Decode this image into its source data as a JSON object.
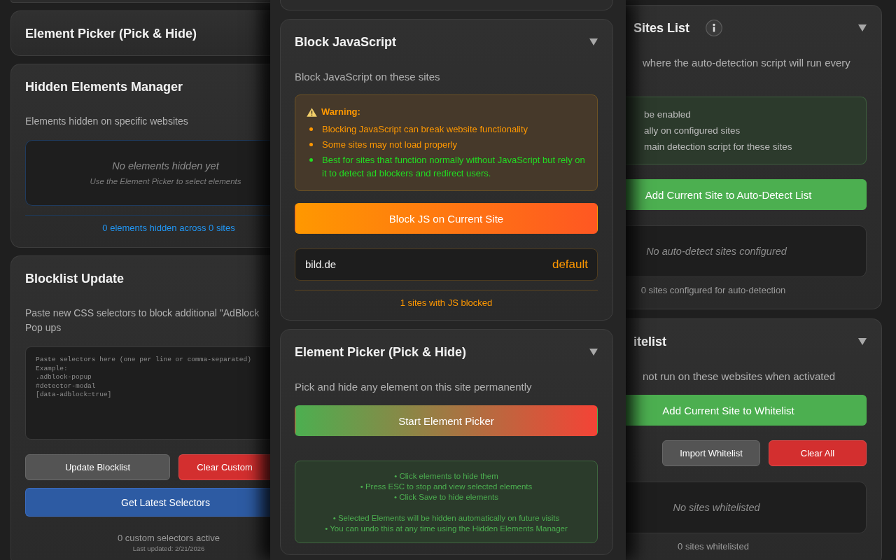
{
  "left_panel": {
    "cards": [
      {
        "kind": "plain",
        "title": "Element Picker (Pick & Hide)"
      },
      {
        "kind": "info",
        "title": "Hidden Elements Manager",
        "blocks": [
          {
            "kind": "description",
            "text": "Elements hidden on specific websites"
          },
          {
            "kind": "empty",
            "title": "No elements hidden yet",
            "hint": "Use the Element Picker to select elements"
          },
          {
            "kind": "divider"
          },
          {
            "kind": "summary",
            "text": "0 elements hidden across 0 sites"
          }
        ]
      },
      {
        "kind": "plain",
        "title": "Blocklist Update",
        "blocks": [
          {
            "kind": "description",
            "text": "Paste new CSS selectors to block additional \"AdBlock\nPop ups"
          },
          {
            "kind": "textarea",
            "placeholder": "Paste selectors here (one per line or comma-separated)\nExample:\n.adblock-popup\n#detector-modal\n[data-adblock=true]"
          },
          {
            "kind": "buttons",
            "buttons": [
              {
                "label": "Update Blocklist",
                "kind": "neutral"
              },
              {
                "label": "Clear Custom",
                "kind": "danger"
              }
            ]
          },
          {
            "kind": "buttons",
            "buttons": [
              {
                "label": "Get Latest Selectors",
                "kind": "primary"
              }
            ]
          },
          {
            "kind": "summary",
            "text": "0 custom selectors active",
            "note": "Last updated: 2/21/2026"
          }
        ]
      }
    ]
  },
  "center_panel": {
    "cards": [
      {
        "kind": "warning",
        "title": "Block JavaScript",
        "blocks": [
          {
            "kind": "description",
            "text": "Block JavaScript on these sites"
          },
          {
            "kind": "warning",
            "title": "Warning:",
            "items": [
              {
                "text": "Blocking JavaScript can break website functionality",
                "color": "#ff9800"
              },
              {
                "text": "Some sites may not load properly",
                "color": "#ff9800"
              },
              {
                "text": "Best for sites that function normally without JavaScript but rely on it to detect ad blockers and redirect users.",
                "color": "#22dd22"
              }
            ]
          },
          {
            "kind": "buttons",
            "buttons": [
              {
                "label": "Block JS on Current Site",
                "kind": "warning"
              }
            ]
          },
          {
            "kind": "sites",
            "sites": [
              {
                "name": "bild.de",
                "tag": "default"
              }
            ]
          },
          {
            "kind": "divider"
          },
          {
            "kind": "summary",
            "text": "1 sites with JS blocked"
          }
        ]
      },
      {
        "kind": "plain",
        "title": "Element Picker (Pick & Hide)",
        "blocks": [
          {
            "kind": "description",
            "text": "Pick and hide any element on this site permanently"
          },
          {
            "kind": "buttons",
            "buttons": [
              {
                "label": "Start Element Picker",
                "kind": "picker"
              }
            ]
          },
          {
            "kind": "tips",
            "groups": [
              [
                "• Click elements to hide them",
                "• Press ESC to stop and view selected elements",
                "• Click Save to hide elements"
              ],
              [
                "• Selected Elements will be hidden automatically on future visits",
                "• You can undo this at any time using the Hidden Elements Manager"
              ]
            ]
          }
        ]
      }
    ]
  },
  "right_panel": {
    "cards": [
      {
        "kind": "plain",
        "title": "Sites List",
        "info_button": true,
        "blocks": [
          {
            "kind": "description",
            "text": "where the auto-detection script will run every"
          },
          {
            "kind": "notes",
            "items": [
              "be enabled",
              "ally on configured sites",
              "main detection script for these sites"
            ]
          },
          {
            "kind": "buttons",
            "buttons": [
              {
                "label": "Add Current Site to Auto-Detect List",
                "kind": "success"
              }
            ]
          },
          {
            "kind": "empty",
            "title": "No auto-detect sites configured"
          },
          {
            "kind": "summary",
            "text": "0 sites configured for auto-detection"
          }
        ]
      },
      {
        "kind": "plain",
        "title": "itelist",
        "blocks": [
          {
            "kind": "description",
            "text": "not run on these websites when activated"
          },
          {
            "kind": "buttons",
            "buttons": [
              {
                "label": "Add Current Site to Whitelist",
                "kind": "success"
              }
            ]
          },
          {
            "kind": "buttons",
            "buttons": [
              {
                "label": "Import Whitelist",
                "kind": "neutral"
              },
              {
                "label": "Clear All",
                "kind": "danger"
              }
            ]
          },
          {
            "kind": "empty",
            "title": "No sites whitelisted"
          },
          {
            "kind": "summary",
            "text": "0 sites whitelisted"
          }
        ]
      }
    ]
  }
}
